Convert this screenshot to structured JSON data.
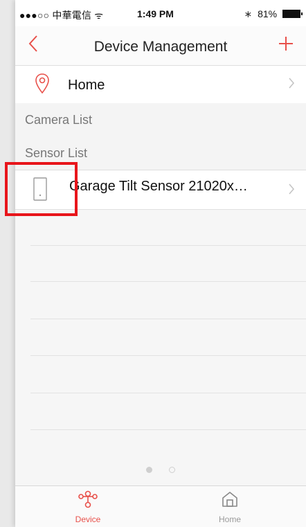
{
  "status_bar": {
    "carrier": "●●●○○ 中華電信 ᯤ",
    "time": "1:49 PM",
    "bluetooth": "∗",
    "battery": "81%"
  },
  "nav": {
    "back_icon": "chevron-left-icon",
    "title": "Device Management",
    "add_icon": "plus-icon"
  },
  "location": {
    "label": "Home",
    "icon": "location-pin-icon"
  },
  "sections": {
    "camera_list": "Camera List",
    "sensor_list": "Sensor List"
  },
  "sensors": [
    {
      "label": "Garage Tilt Sensor 21020x…",
      "icon": "door-sensor-icon"
    }
  ],
  "pager": {
    "pages": 2,
    "active": 1
  },
  "tabbar": {
    "device_label": "Device",
    "home_label": "Home"
  },
  "colors": {
    "accent": "#e8504a",
    "highlight": "#e8151b"
  }
}
